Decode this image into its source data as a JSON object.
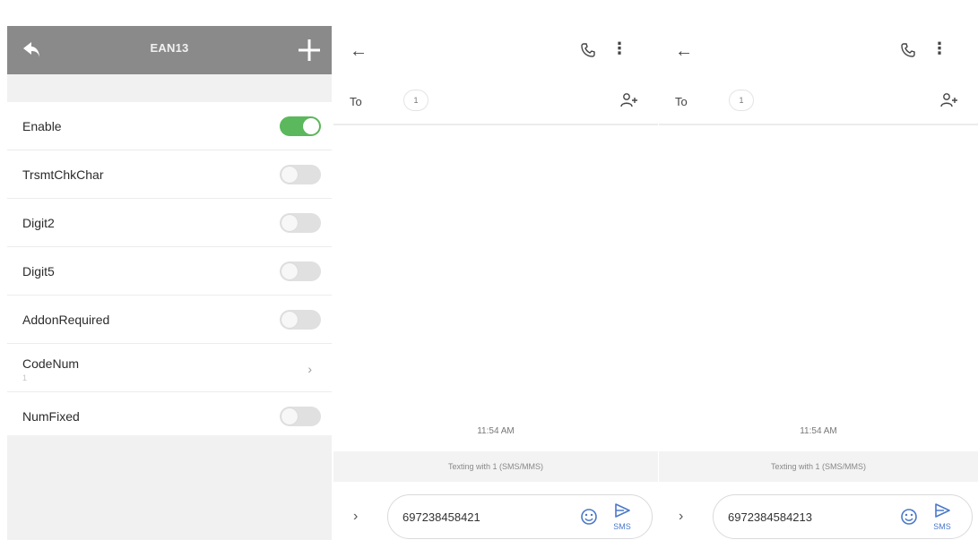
{
  "settings": {
    "title": "EAN13",
    "rows": [
      {
        "label": "Enable",
        "type": "toggle",
        "on": true
      },
      {
        "label": "TrsmtChkChar",
        "type": "toggle",
        "on": false
      },
      {
        "label": "Digit2",
        "type": "toggle",
        "on": false
      },
      {
        "label": "Digit5",
        "type": "toggle",
        "on": false
      },
      {
        "label": "AddonRequired",
        "type": "toggle",
        "on": false
      },
      {
        "label": "CodeNum",
        "sub": "1",
        "type": "link",
        "chevron": "›"
      },
      {
        "label": "NumFixed",
        "type": "toggle",
        "on": false
      }
    ]
  },
  "panes": [
    {
      "to_label": "To",
      "recipient_chip": "1",
      "timestamp": "11:54 AM",
      "banner": "Texting with 1 (SMS/MMS)",
      "compose_text": "697238458421",
      "send_label": "SMS"
    },
    {
      "to_label": "To",
      "recipient_chip": "1",
      "timestamp": "11:54 AM",
      "banner": "Texting with 1 (SMS/MMS)",
      "compose_text": "6972384584213",
      "send_label": "SMS"
    }
  ],
  "icons": {
    "back": "back-arrow-icon",
    "add": "plus-icon",
    "phone": "phone-icon",
    "more": "more-vert-icon",
    "add_person": "add-person-icon",
    "emoji": "emoji-icon",
    "send": "send-icon",
    "expand": "chevron-right-icon"
  },
  "colors": {
    "topbar": "#8a8a8a",
    "toggle_on": "#5cb85c",
    "toggle_off": "#e0e0e0",
    "accent_blue": "#4a78c9"
  }
}
